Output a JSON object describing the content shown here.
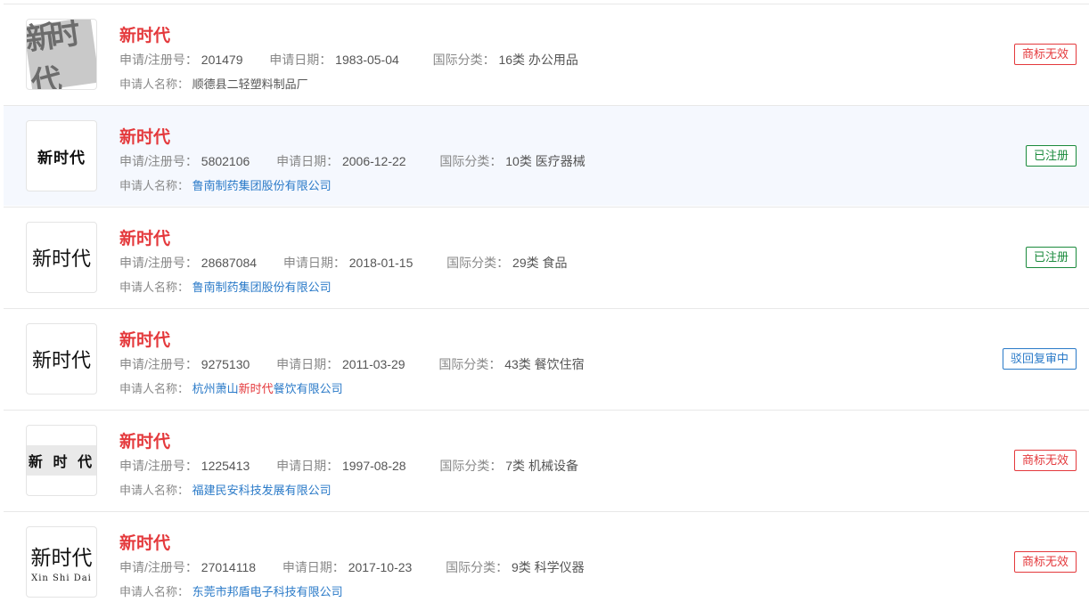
{
  "labels": {
    "reg_no": "申请/注册号：",
    "app_date": "申请日期：",
    "intl_class": "国际分类：",
    "applicant": "申请人名称："
  },
  "rows": [
    {
      "title": "新时代",
      "reg_no": "201479",
      "app_date": "1983-05-04",
      "intl_class": "16类 办公用品",
      "applicant": "顺德县二轻塑料制品厂",
      "status": "商标无效",
      "logo_text": "新时代"
    },
    {
      "title": "新时代",
      "reg_no": "5802106",
      "app_date": "2006-12-22",
      "intl_class": "10类 医疗器械",
      "applicant": "鲁南制药集团股份有限公司",
      "status": "已注册",
      "logo_text": "新时代"
    },
    {
      "title": "新时代",
      "reg_no": "28687084",
      "app_date": "2018-01-15",
      "intl_class": "29类 食品",
      "applicant": "鲁南制药集团股份有限公司",
      "status": "已注册",
      "logo_text": "新时代"
    },
    {
      "title": "新时代",
      "reg_no": "9275130",
      "app_date": "2011-03-29",
      "intl_class": "43类 餐饮住宿",
      "applicant_pre": "杭州萧山",
      "applicant_hl": "新时代",
      "applicant_post": "餐饮有限公司",
      "status": "驳回复审中",
      "logo_text": "新时代"
    },
    {
      "title": "新时代",
      "reg_no": "1225413",
      "app_date": "1997-08-28",
      "intl_class": "7类 机械设备",
      "applicant": "福建民安科技发展有限公司",
      "status": "商标无效",
      "logo_text": "新 时 代"
    },
    {
      "title": "新时代",
      "reg_no": "27014118",
      "app_date": "2017-10-23",
      "intl_class": "9类 科学仪器",
      "applicant": "东莞市邦盾电子科技有限公司",
      "status": "商标无效",
      "logo_text": "新时代",
      "logo_pinyin": "Xin Shi Dai"
    }
  ],
  "colors": {
    "title_red": "#e4393c",
    "link_blue": "#2a7ac8",
    "registered_green": "#1a8a3c",
    "highlight_row_bg": "#f5f8fe"
  },
  "icons": [
    "trademark-logo-image"
  ]
}
